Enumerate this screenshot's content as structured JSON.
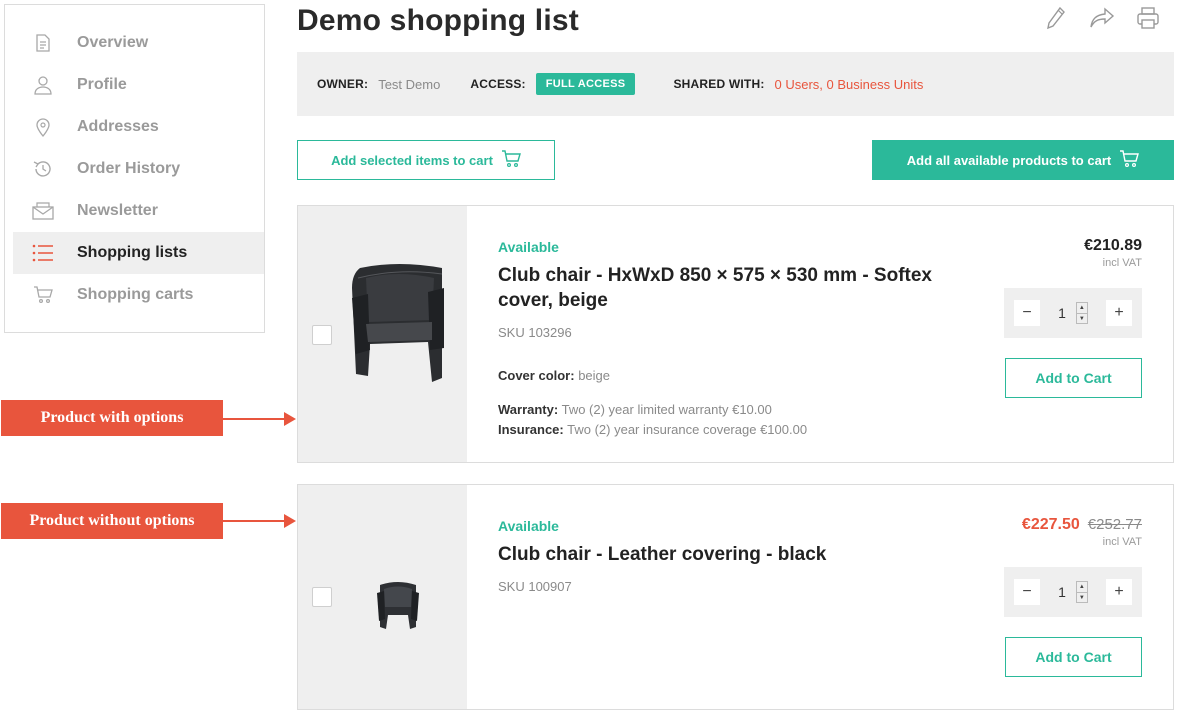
{
  "page": {
    "title": "Demo shopping list"
  },
  "header_icons": [
    "edit-icon",
    "share-icon",
    "print-icon"
  ],
  "sidebar": {
    "items": [
      {
        "label": "Overview",
        "icon": "document-icon",
        "active": false
      },
      {
        "label": "Profile",
        "icon": "user-icon",
        "active": false
      },
      {
        "label": "Addresses",
        "icon": "location-pin-icon",
        "active": false
      },
      {
        "label": "Order History",
        "icon": "history-icon",
        "active": false
      },
      {
        "label": "Newsletter",
        "icon": "envelope-icon",
        "active": false
      },
      {
        "label": "Shopping lists",
        "icon": "list-icon",
        "active": true
      },
      {
        "label": "Shopping carts",
        "icon": "cart-icon",
        "active": false
      }
    ]
  },
  "info": {
    "owner_label": "OWNER:",
    "owner_value": "Test Demo",
    "access_label": "ACCESS:",
    "access_badge": "FULL ACCESS",
    "shared_label": "SHARED WITH:",
    "shared_value": "0 Users, 0 Business Units"
  },
  "actions": {
    "add_selected": "Add selected items to cart",
    "add_all": "Add all available products to cart"
  },
  "products": [
    {
      "availability": "Available",
      "name": "Club chair - HxWxD 850 × 575 × 530 mm - Softex cover, beige",
      "sku": "SKU 103296",
      "price": "€210.89",
      "vat": "incl VAT",
      "quantity": "1",
      "add_to_cart": "Add to Cart",
      "options": [
        {
          "label": "Cover color:",
          "value": "beige"
        },
        {
          "label": "Warranty:",
          "value": "Two (2) year limited warranty €10.00"
        },
        {
          "label": "Insurance:",
          "value": "Two (2) year insurance coverage €100.00"
        }
      ]
    },
    {
      "availability": "Available",
      "name": "Club chair - Leather covering - black",
      "sku": "SKU 100907",
      "price_sale": "€227.50",
      "price_old": "€252.77",
      "vat": "incl VAT",
      "quantity": "1",
      "add_to_cart": "Add to Cart"
    }
  ],
  "annotations": {
    "with_options": "Product with options",
    "without_options": "Product without options"
  },
  "colors": {
    "accent": "#2bb99a",
    "highlight": "#e8553d",
    "panel": "#efefef"
  }
}
